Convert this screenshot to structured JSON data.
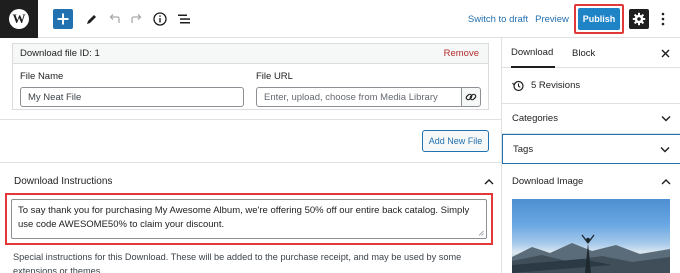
{
  "toolbar": {
    "logo_letter": "W",
    "switch_to_draft": "Switch to draft",
    "preview": "Preview",
    "publish": "Publish",
    "icons": [
      "add-block-icon",
      "pen-tool-icon",
      "undo-icon",
      "redo-icon",
      "info-icon",
      "list-view-icon",
      "settings-gear-icon",
      "more-options-icon"
    ]
  },
  "download_file": {
    "id_label": "Download file ID: 1",
    "remove": "Remove",
    "file_name_label": "File Name",
    "file_name_value": "My Neat File",
    "file_url_label": "File URL",
    "file_url_placeholder": "Enter, upload, choose from Media Library"
  },
  "add_new_file": "Add New File",
  "instructions": {
    "title": "Download Instructions",
    "text": "To say thank you for purchasing My Awesome Album, we're offering 50% off our entire back catalog. Simply use code AWESOME50% to claim your discount.",
    "help": "Special instructions for this Download. These will be added to the purchase receipt, and may be used by some extensions or themes."
  },
  "sidebar": {
    "tabs": [
      "Download",
      "Block"
    ],
    "active_tab": "Download",
    "revisions": "5 Revisions",
    "categories": "Categories",
    "tags": "Tags",
    "download_image": "Download Image"
  },
  "colors": {
    "accent": "#2271b1",
    "publish": "#1e84c6",
    "highlight": "#e2383a",
    "remove": "#b32d2e"
  }
}
